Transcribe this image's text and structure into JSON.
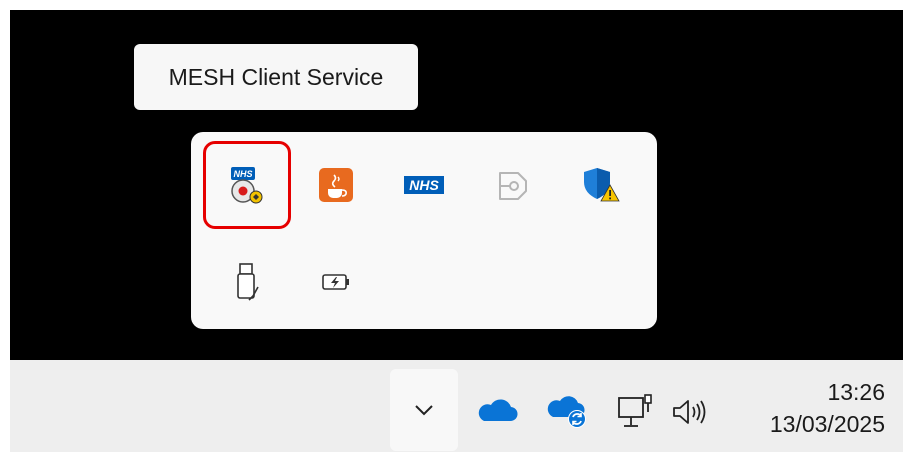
{
  "tooltip": {
    "text": "MESH Client Service"
  },
  "overflow": {
    "icons": [
      {
        "name": "mesh-client-service-icon",
        "selected": true
      },
      {
        "name": "java-icon"
      },
      {
        "name": "nhs-icon",
        "text": "NHS"
      },
      {
        "name": "security-key-icon"
      },
      {
        "name": "windows-security-warning-icon"
      },
      {
        "name": "usb-drive-icon"
      },
      {
        "name": "battery-charging-icon"
      }
    ]
  },
  "taskbar": {
    "time": "13:26",
    "date": "13/03/2025"
  },
  "colors": {
    "highlight": "#e60000",
    "nhs_blue": "#005eb8",
    "onedrive_blue": "#0a74d6",
    "java_orange": "#e86a1f"
  }
}
